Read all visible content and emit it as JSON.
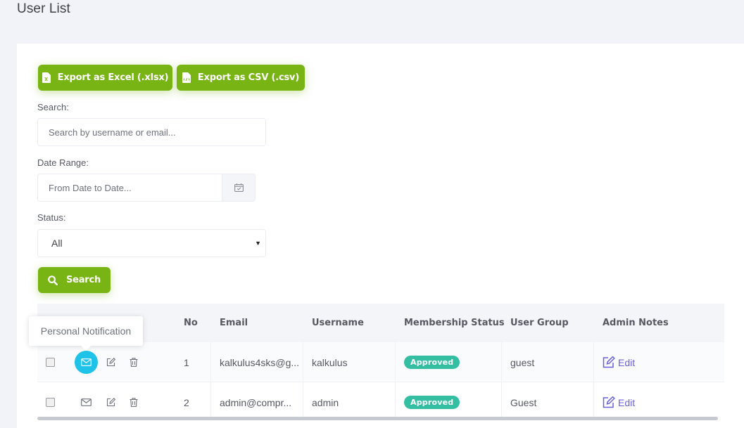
{
  "page": {
    "title": "User List"
  },
  "toolbar": {
    "export_excel_label": "Export as Excel (.xlsx)",
    "export_csv_label": "Export as CSV (.csv)"
  },
  "filters": {
    "search_label": "Search:",
    "search_placeholder": "Search by username or email...",
    "date_label": "Date Range:",
    "date_placeholder": "From Date to Date...",
    "status_label": "Status:",
    "status_selected": "All",
    "search_button_label": "Search"
  },
  "table": {
    "columns": [
      "No",
      "Email",
      "Username",
      "Membership Status",
      "User Group",
      "Admin Notes"
    ],
    "rows": [
      {
        "no": "1",
        "email": "kalkulus4sks@g...",
        "username": "kalkulus",
        "status": "Approved",
        "group": "guest",
        "notes": "Edit"
      },
      {
        "no": "2",
        "email": "admin@compr...",
        "username": "admin",
        "status": "Approved",
        "group": "Guest",
        "notes": "Edit"
      }
    ]
  },
  "tooltip": {
    "text": "Personal Notification"
  },
  "colors": {
    "accent_green": "#78b414",
    "approved_badge": "#34bfa3",
    "notification_active": "#1fc3e8",
    "edit_link": "#6a61dd"
  }
}
